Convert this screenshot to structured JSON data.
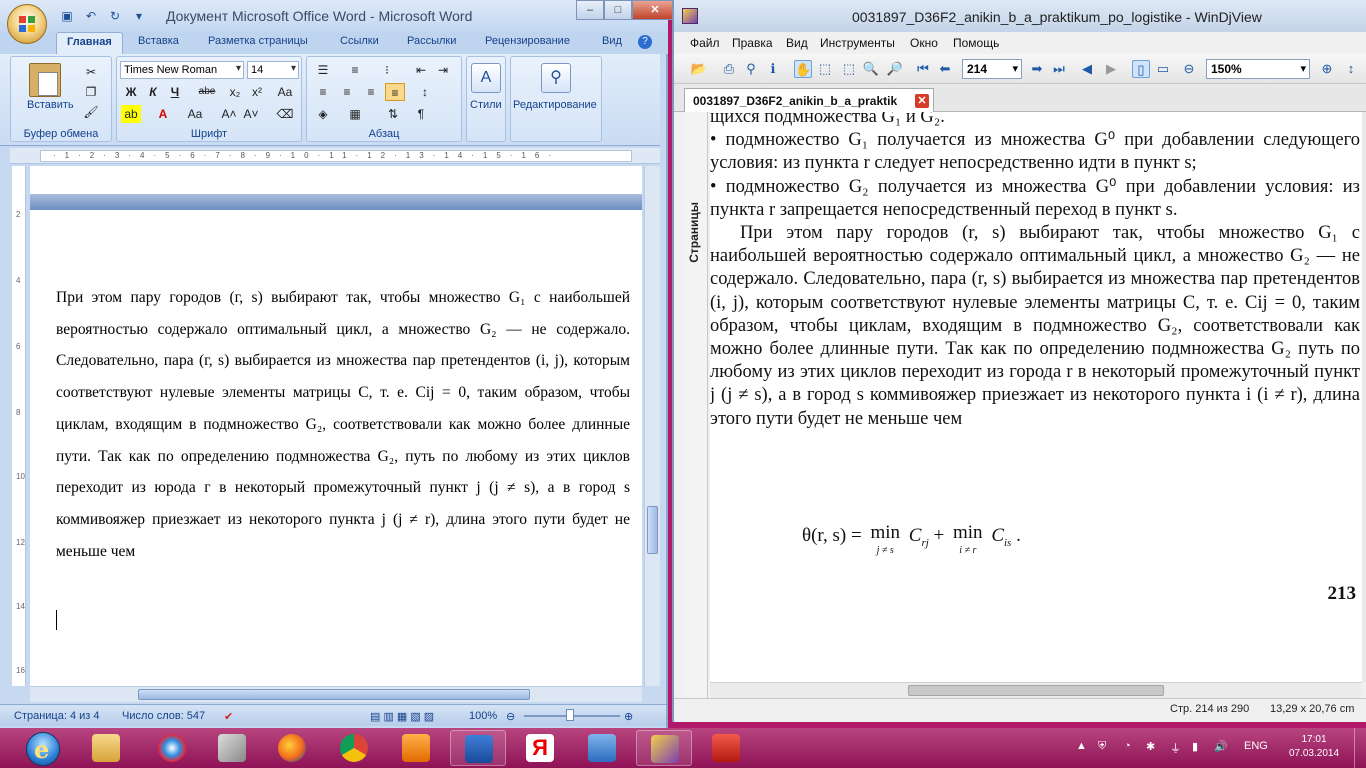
{
  "word": {
    "title": "Документ Microsoft Office Word - Microsoft Word",
    "tabs": [
      "Главная",
      "Вставка",
      "Разметка страницы",
      "Ссылки",
      "Рассылки",
      "Рецензирование",
      "Вид"
    ],
    "ribbon": {
      "paste_label": "Вставить",
      "clipboard_group": "Буфер обмена",
      "font_name": "Times New Roman",
      "font_size": "14",
      "font_group": "Шрифт",
      "bold": "Ж",
      "italic": "К",
      "underline": "Ч",
      "strike": "abe",
      "paragraph_group": "Абзац",
      "styles_label": "Стили",
      "editing_label": "Редактирование"
    },
    "document_text": "При этом пару городов (г, s) выбирают так, чтобы множество G₁ с наибольшей вероятностью содержало оптимальный цикл, а множество G₂ — не содержало. Следовательно, пара (г, s) выбирается из множества пар претендентов (i, j), которым соответствуют нулевые элементы матрицы C, т. е. Cij = 0, таким образом, чтобы циклам, входящим в подмножество G₂, соответствовали как можно более длинные пути. Так как по определению подмножества G₂, путь по любому из этих циклов переходит из юрода г в некоторый промежуточный пункт j (j ≠ s), а в город s коммивояжер приезжает из некоторого пункта j (j ≠ r), длина этого пути будет не меньше чем",
    "status": {
      "page": "Страница: 4 из 4",
      "words": "Число слов: 547",
      "zoom": "100%"
    }
  },
  "djview": {
    "title": "0031897_D36F2_anikin_b_a_praktikum_po_logistike - WinDjView",
    "menu": [
      "Файл",
      "Правка",
      "Вид",
      "Инструменты",
      "Окно",
      "Помощь"
    ],
    "page_input": "214",
    "zoom": "150%",
    "tab_label": "0031897_D36F2_anikin_b_a_praktik",
    "side_tab": "Страницы",
    "page_head": "щихся подмножества G₁ и G₂.",
    "bullet1": "• подмножество G₁ получается из множества G⁰ при добавлении следующего условия: из пункта r следует непосредственно идти в пункт s;",
    "bullet2": "• подмножество G₂ получается из множества G⁰ при добавлении условия: из пункта r запрещается непосредственный переход в пункт s.",
    "para": "При этом пару городов (r, s) выбирают так, чтобы множество G₁ с наибольшей вероятностью содержало оптимальный цикл, а множество G₂ — не содержало. Следовательно, пара (r, s) выбирается из множества пар претендентов (i, j), которым соответствуют нулевые элементы матрицы C, т. е. Cij = 0, таким образом, чтобы циклам, входящим в подмножество G₂, соответствовали как можно более длинные пути. Так как по определению подмножества G₂ путь по любому из этих циклов переходит из города r в некоторый промежуточный пункт j (j ≠ s), а в город s коммивояжер приезжает из некоторого пункта i (i ≠ r), длина этого пути будет не меньше чем",
    "formula_lhs": "θ(r, s) =",
    "formula_min": "min",
    "formula_sub1": "j ≠ s",
    "formula_term1": "C",
    "formula_term1_sub": "rj",
    "formula_plus": "+",
    "formula_sub2": "i ≠ r",
    "formula_term2": "C",
    "formula_term2_sub": "is",
    "formula_end": ".",
    "page_number": "213",
    "status_page": "Стр. 214 из 290",
    "status_size": "13,29 x 20,76 cm"
  },
  "taskbar": {
    "lang": "ENG",
    "time": "17:01",
    "date": "07.03.2014"
  },
  "colors": {
    "desktop": "#b0196a",
    "word_ribbon": "#c6d9f1",
    "word_accent": "#15428b"
  }
}
